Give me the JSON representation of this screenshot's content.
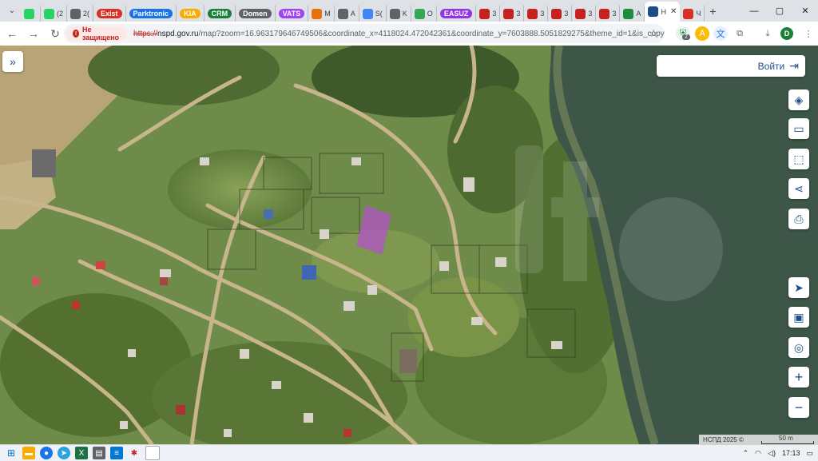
{
  "browser": {
    "tabs": [
      {
        "fav": "tab-menu",
        "label": ""
      },
      {
        "fav": "whatsapp",
        "color": "#25d366",
        "label": ""
      },
      {
        "fav": "whatsapp",
        "color": "#25d366",
        "label": "(2"
      },
      {
        "fav": "globe",
        "color": "#5f6368",
        "label": "2("
      },
      {
        "fav": "pill",
        "color": "#d93025",
        "label": "Exist"
      },
      {
        "fav": "pill",
        "color": "#1a73e8",
        "label": "Parktronic"
      },
      {
        "fav": "pill",
        "color": "#f9ab00",
        "label": "KIA"
      },
      {
        "fav": "pill",
        "color": "#188038",
        "label": "CRM"
      },
      {
        "fav": "pill",
        "color": "#5f6368",
        "label": "Domen"
      },
      {
        "fav": "pill",
        "color": "#a142f4",
        "label": "VATS"
      },
      {
        "fav": "box",
        "color": "#e8710a",
        "label": "M"
      },
      {
        "fav": "circle",
        "color": "#5f6368",
        "label": "A"
      },
      {
        "fav": "google",
        "color": "#4285f4",
        "label": "S("
      },
      {
        "fav": "box",
        "color": "#5f6368",
        "label": "K"
      },
      {
        "fav": "drive",
        "color": "#34a853",
        "label": "O"
      },
      {
        "fav": "pill",
        "color": "#9334e6",
        "label": "EASUZ"
      },
      {
        "fav": "box",
        "color": "#c5221f",
        "label": "3"
      },
      {
        "fav": "box",
        "color": "#c5221f",
        "label": "3"
      },
      {
        "fav": "box",
        "color": "#c5221f",
        "label": "3"
      },
      {
        "fav": "box",
        "color": "#c5221f",
        "label": "3"
      },
      {
        "fav": "box",
        "color": "#c5221f",
        "label": "3"
      },
      {
        "fav": "box",
        "color": "#c5221f",
        "label": "3"
      },
      {
        "fav": "box",
        "color": "#1e8e3e",
        "label": "A"
      },
      {
        "fav": "active",
        "color": "#1d4e89",
        "label": "H"
      },
      {
        "fav": "pin",
        "color": "#d93025",
        "label": "Ч"
      }
    ],
    "active_tab_label": "H",
    "address": {
      "security_label": "Не защищено",
      "scheme": "https://",
      "host": "nspd.gov.ru",
      "path": "/map?zoom=16.963179646749506&coordinate_x=4118024.472042361&coordinate_y=7603888.5051829275&theme_id=1&is_copy_url..."
    },
    "extension_badge": "2",
    "profile_initial": "D"
  },
  "map": {
    "login_label": "Войти",
    "attribution": "НСПД 2025 ©",
    "scale_label": "50 m",
    "controls": [
      "layers-icon",
      "ruler-icon",
      "select-area-icon",
      "share-icon",
      "print-icon",
      "navigate-icon",
      "minimap-icon",
      "locate-icon",
      "zoom-in-icon",
      "zoom-out-icon"
    ],
    "colors": {
      "water": "#3d5648",
      "highlight": "#b84fd0",
      "panel_text": "#1d4e89"
    }
  },
  "taskbar": {
    "time": "17:13",
    "apps": [
      "start-icon",
      "search-icon",
      "file-explorer-icon",
      "chrome-icon",
      "telegram-icon",
      "excel-icon",
      "app-icon",
      "notepad-icon",
      "settings-icon",
      "sticky-icon"
    ]
  }
}
